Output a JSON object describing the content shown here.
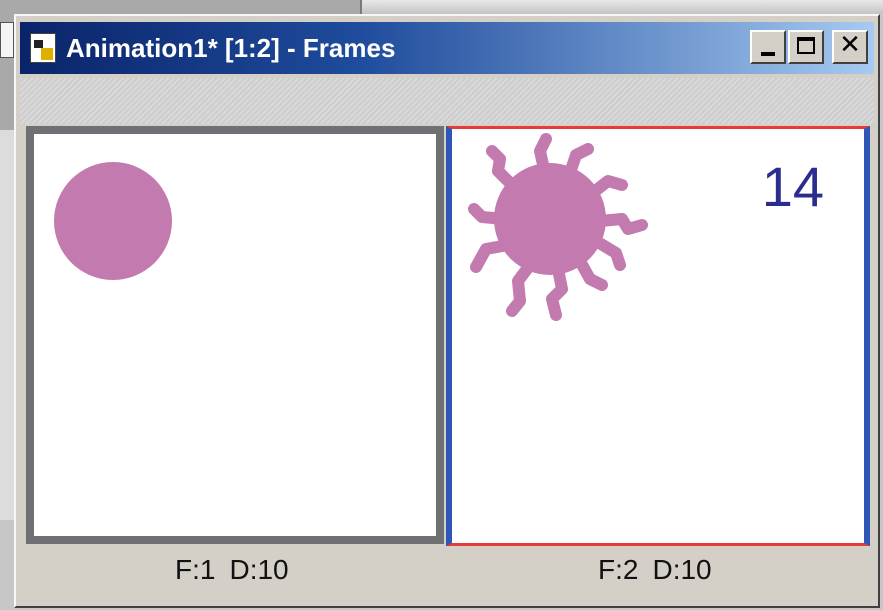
{
  "window": {
    "title": "Animation1* [1:2] - Frames",
    "buttons": {
      "minimize": "_",
      "maximize": "□",
      "close": "✕"
    }
  },
  "frames": [
    {
      "frame_label": "F:1",
      "delay_label": "D:10",
      "shape": "circle",
      "selected": false
    },
    {
      "frame_label": "F:2",
      "delay_label": "D:10",
      "shape": "splat",
      "selected": true,
      "number": "14"
    }
  ],
  "colors": {
    "shape": "#c27aaf",
    "selected_border": "#2e56b5",
    "selected_accent": "#e63b3b",
    "frame_number": "#2a2d8e"
  },
  "icons": {
    "app": "document-app-icon"
  }
}
